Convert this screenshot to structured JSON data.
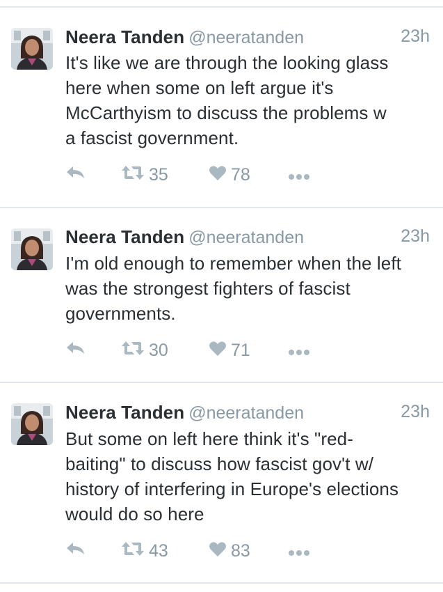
{
  "colors": {
    "text": "#292f33",
    "secondary": "#8899a6",
    "icon": "#aab8c2",
    "divider": "#e1e8ed"
  },
  "icons": {
    "reply": "reply-icon",
    "retweet": "retweet-icon",
    "like": "heart-icon",
    "more": "more-dots-icon"
  },
  "tweets": [
    {
      "name": "Neera Tanden",
      "handle": "@neeratanden",
      "time": "23h",
      "text_lines": [
        "It's like we are through the looking glass",
        "here when some on left argue it's",
        "McCarthyism to discuss the problems w",
        "a fascist government."
      ],
      "retweets": "35",
      "likes": "78"
    },
    {
      "name": "Neera Tanden",
      "handle": "@neeratanden",
      "time": "23h",
      "text_lines": [
        "I'm old enough to remember when the left",
        "was the strongest fighters of fascist",
        "governments."
      ],
      "retweets": "30",
      "likes": "71"
    },
    {
      "name": "Neera Tanden",
      "handle": "@neeratanden",
      "time": "23h",
      "text_lines": [
        "But some on left here think it's \"red-",
        "baiting\" to discuss how fascist gov't w/",
        "history of interfering in Europe's elections",
        "would do so here"
      ],
      "retweets": "43",
      "likes": "83"
    }
  ]
}
